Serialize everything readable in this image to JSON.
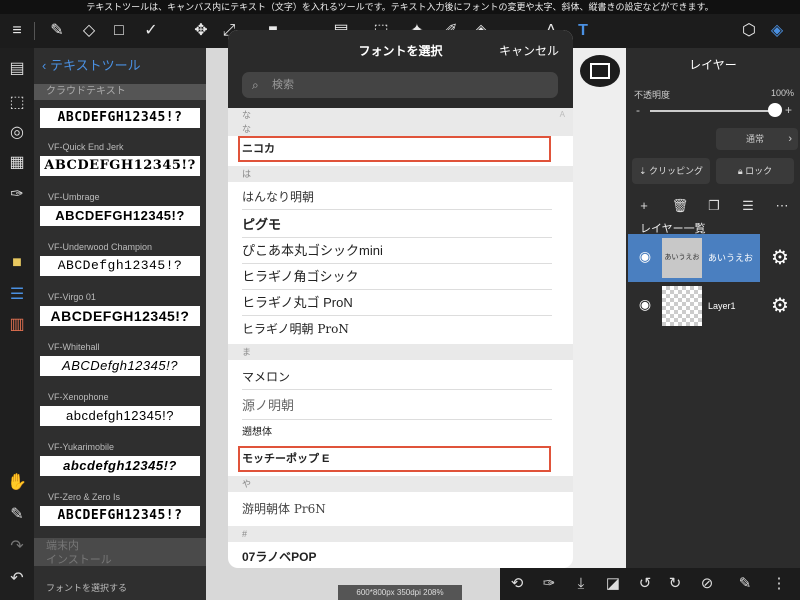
{
  "info_bar": "テキストツールは、キャンバス内にテキスト（文字）を入れるツールです。テキスト入力後にフォントの変更や太字、斜体、縦書きの設定などができます。",
  "toolbar": {
    "icons": [
      "menu-icon",
      "brush-icon",
      "eraser-icon",
      "shape-icon",
      "check-brush-icon",
      "move-icon",
      "transform-icon",
      "fill-icon",
      "gradient-icon",
      "select-icon",
      "magic-wand-icon",
      "pen-select-icon",
      "eraser-select-icon",
      "text-icon",
      "3d-icon",
      "layers-icon"
    ]
  },
  "text_panel": {
    "back_label": "テキストツール",
    "section_label": "クラウドテキスト",
    "fonts": [
      {
        "name": "",
        "sample": "ABCDEFGH12345!?"
      },
      {
        "name": "VF-Quick End Jerk",
        "sample": "ABCDEFGH12345!?"
      },
      {
        "name": "VF-Umbrage",
        "sample": "ABCDEFGH12345!?"
      },
      {
        "name": "VF-Underwood Champion",
        "sample": "ABCDefgh12345!?"
      },
      {
        "name": "VF-Virgo 01",
        "sample": "ABCDEFGH12345!?"
      },
      {
        "name": "VF-Whitehall",
        "sample": "ABCDefgh12345!?"
      },
      {
        "name": "VF-Xenophone",
        "sample": "abcdefgh12345!?"
      },
      {
        "name": "VF-Yukarimobile",
        "sample": "abcdefgh12345!?"
      },
      {
        "name": "VF-Zero & Zero Is",
        "sample": "ABCDEFGH12345!?"
      }
    ],
    "bottom_section_1": "端末内",
    "bottom_section_2": "インストール",
    "footer_label": "フォントを選択する"
  },
  "modal": {
    "title": "フォントを選択",
    "cancel": "キャンセル",
    "search_placeholder": "検索",
    "sections": [
      {
        "header": "な",
        "index": "A",
        "fonts": [
          "ニコカ"
        ]
      },
      {
        "header": "は",
        "index": "",
        "fonts": [
          "はんなり明朝",
          "ピグモ",
          "ぴこあ本丸ゴシックmini",
          "ヒラギノ角ゴシック",
          "ヒラギノ丸ゴ ProN",
          "ヒラギノ明朝 ProN"
        ]
      },
      {
        "header": "ま",
        "index": "",
        "fonts": [
          "マメロン",
          "源ノ明朝",
          "遡想体",
          "モッチーポップ E"
        ]
      },
      {
        "header": "や",
        "index": "",
        "fonts": [
          "游明朝体 Pr6N"
        ]
      },
      {
        "header": "#",
        "index": "",
        "fonts": [
          "07ラノベPOP"
        ]
      }
    ],
    "selected_fonts": [
      "ニコカ",
      "モッチーポップ E"
    ]
  },
  "layers": {
    "title": "レイヤー",
    "opacity_label": "不透明度",
    "opacity_value": "100%",
    "opacity_level": 1.0,
    "blend_mode": "通常",
    "clipping_label": "クリッピング",
    "lock_label": "ロック",
    "list_title": "レイヤー一覧",
    "items": [
      {
        "thumb_text": "あいうえお",
        "label": "あいうえお",
        "selected": true
      },
      {
        "thumb_text": "",
        "label": "Layer1",
        "selected": false
      }
    ]
  },
  "status": "600*800px 350dpi 208%",
  "colors": {
    "accent": "#4a90e2",
    "selection": "#e0533a",
    "layer_selected": "#4a7fc0"
  }
}
